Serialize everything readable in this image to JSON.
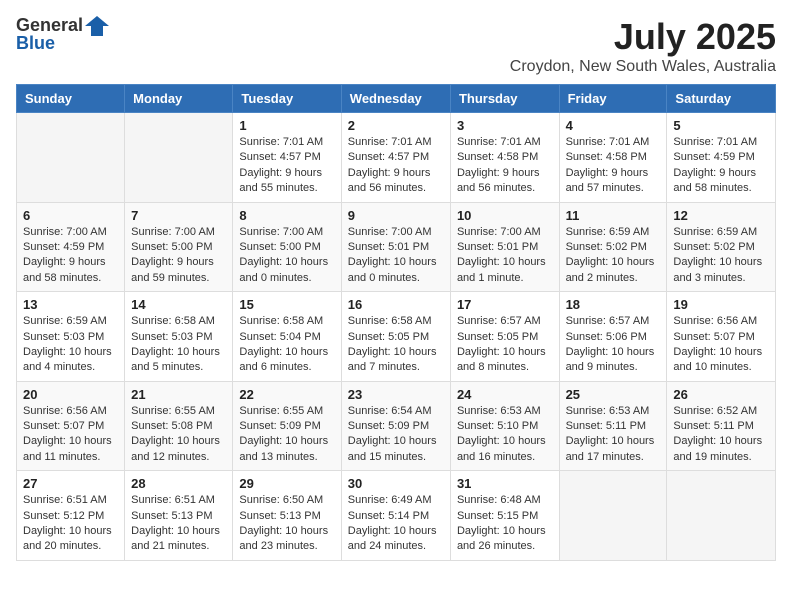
{
  "header": {
    "logo_general": "General",
    "logo_blue": "Blue",
    "month_year": "July 2025",
    "location": "Croydon, New South Wales, Australia"
  },
  "days_of_week": [
    "Sunday",
    "Monday",
    "Tuesday",
    "Wednesday",
    "Thursday",
    "Friday",
    "Saturday"
  ],
  "weeks": [
    [
      {
        "day": "",
        "info": ""
      },
      {
        "day": "",
        "info": ""
      },
      {
        "day": "1",
        "info": "Sunrise: 7:01 AM\nSunset: 4:57 PM\nDaylight: 9 hours and 55 minutes."
      },
      {
        "day": "2",
        "info": "Sunrise: 7:01 AM\nSunset: 4:57 PM\nDaylight: 9 hours and 56 minutes."
      },
      {
        "day": "3",
        "info": "Sunrise: 7:01 AM\nSunset: 4:58 PM\nDaylight: 9 hours and 56 minutes."
      },
      {
        "day": "4",
        "info": "Sunrise: 7:01 AM\nSunset: 4:58 PM\nDaylight: 9 hours and 57 minutes."
      },
      {
        "day": "5",
        "info": "Sunrise: 7:01 AM\nSunset: 4:59 PM\nDaylight: 9 hours and 58 minutes."
      }
    ],
    [
      {
        "day": "6",
        "info": "Sunrise: 7:00 AM\nSunset: 4:59 PM\nDaylight: 9 hours and 58 minutes."
      },
      {
        "day": "7",
        "info": "Sunrise: 7:00 AM\nSunset: 5:00 PM\nDaylight: 9 hours and 59 minutes."
      },
      {
        "day": "8",
        "info": "Sunrise: 7:00 AM\nSunset: 5:00 PM\nDaylight: 10 hours and 0 minutes."
      },
      {
        "day": "9",
        "info": "Sunrise: 7:00 AM\nSunset: 5:01 PM\nDaylight: 10 hours and 0 minutes."
      },
      {
        "day": "10",
        "info": "Sunrise: 7:00 AM\nSunset: 5:01 PM\nDaylight: 10 hours and 1 minute."
      },
      {
        "day": "11",
        "info": "Sunrise: 6:59 AM\nSunset: 5:02 PM\nDaylight: 10 hours and 2 minutes."
      },
      {
        "day": "12",
        "info": "Sunrise: 6:59 AM\nSunset: 5:02 PM\nDaylight: 10 hours and 3 minutes."
      }
    ],
    [
      {
        "day": "13",
        "info": "Sunrise: 6:59 AM\nSunset: 5:03 PM\nDaylight: 10 hours and 4 minutes."
      },
      {
        "day": "14",
        "info": "Sunrise: 6:58 AM\nSunset: 5:03 PM\nDaylight: 10 hours and 5 minutes."
      },
      {
        "day": "15",
        "info": "Sunrise: 6:58 AM\nSunset: 5:04 PM\nDaylight: 10 hours and 6 minutes."
      },
      {
        "day": "16",
        "info": "Sunrise: 6:58 AM\nSunset: 5:05 PM\nDaylight: 10 hours and 7 minutes."
      },
      {
        "day": "17",
        "info": "Sunrise: 6:57 AM\nSunset: 5:05 PM\nDaylight: 10 hours and 8 minutes."
      },
      {
        "day": "18",
        "info": "Sunrise: 6:57 AM\nSunset: 5:06 PM\nDaylight: 10 hours and 9 minutes."
      },
      {
        "day": "19",
        "info": "Sunrise: 6:56 AM\nSunset: 5:07 PM\nDaylight: 10 hours and 10 minutes."
      }
    ],
    [
      {
        "day": "20",
        "info": "Sunrise: 6:56 AM\nSunset: 5:07 PM\nDaylight: 10 hours and 11 minutes."
      },
      {
        "day": "21",
        "info": "Sunrise: 6:55 AM\nSunset: 5:08 PM\nDaylight: 10 hours and 12 minutes."
      },
      {
        "day": "22",
        "info": "Sunrise: 6:55 AM\nSunset: 5:09 PM\nDaylight: 10 hours and 13 minutes."
      },
      {
        "day": "23",
        "info": "Sunrise: 6:54 AM\nSunset: 5:09 PM\nDaylight: 10 hours and 15 minutes."
      },
      {
        "day": "24",
        "info": "Sunrise: 6:53 AM\nSunset: 5:10 PM\nDaylight: 10 hours and 16 minutes."
      },
      {
        "day": "25",
        "info": "Sunrise: 6:53 AM\nSunset: 5:11 PM\nDaylight: 10 hours and 17 minutes."
      },
      {
        "day": "26",
        "info": "Sunrise: 6:52 AM\nSunset: 5:11 PM\nDaylight: 10 hours and 19 minutes."
      }
    ],
    [
      {
        "day": "27",
        "info": "Sunrise: 6:51 AM\nSunset: 5:12 PM\nDaylight: 10 hours and 20 minutes."
      },
      {
        "day": "28",
        "info": "Sunrise: 6:51 AM\nSunset: 5:13 PM\nDaylight: 10 hours and 21 minutes."
      },
      {
        "day": "29",
        "info": "Sunrise: 6:50 AM\nSunset: 5:13 PM\nDaylight: 10 hours and 23 minutes."
      },
      {
        "day": "30",
        "info": "Sunrise: 6:49 AM\nSunset: 5:14 PM\nDaylight: 10 hours and 24 minutes."
      },
      {
        "day": "31",
        "info": "Sunrise: 6:48 AM\nSunset: 5:15 PM\nDaylight: 10 hours and 26 minutes."
      },
      {
        "day": "",
        "info": ""
      },
      {
        "day": "",
        "info": ""
      }
    ]
  ]
}
